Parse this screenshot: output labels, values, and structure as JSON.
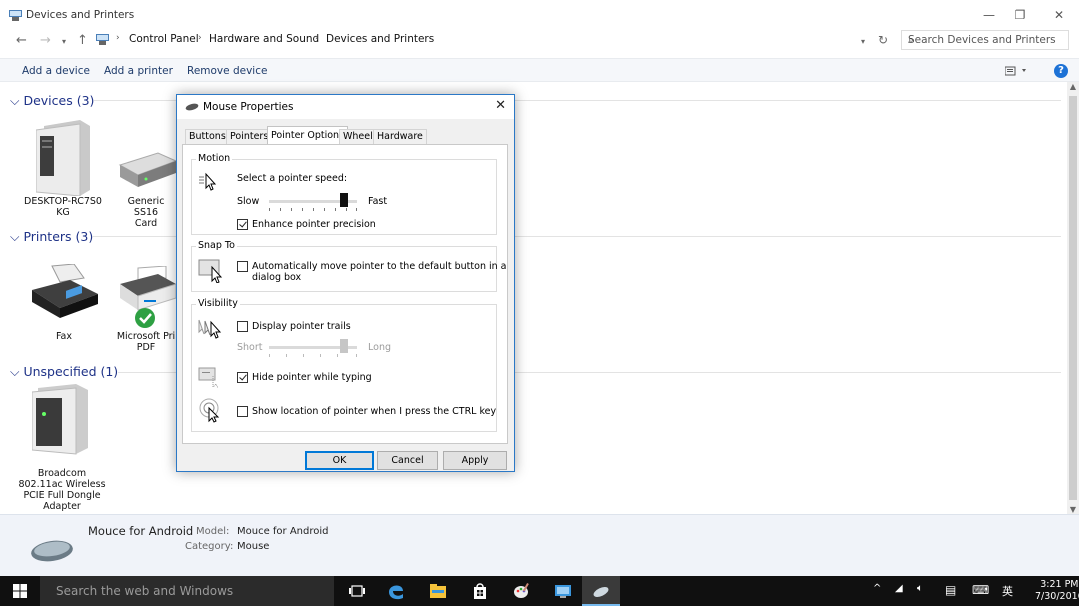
{
  "window": {
    "title": "Devices and Printers",
    "controls": [
      "—",
      "❐",
      "✕"
    ]
  },
  "address": {
    "crumbs": [
      "Control Panel",
      "Hardware and Sound",
      "Devices and Printers"
    ],
    "search_placeholder": "Search Devices and Printers"
  },
  "commands": {
    "add_device": "Add a device",
    "add_printer": "Add a printer",
    "remove_device": "Remove device",
    "help": "?"
  },
  "groups": {
    "devices": {
      "header": "Devices (3)",
      "items": [
        {
          "label1": "DESKTOP-RC7S0",
          "label2": "KG"
        },
        {
          "label1": "Generic SS16",
          "label2": "Card"
        }
      ]
    },
    "printers": {
      "header": "Printers (3)",
      "items": [
        {
          "label1": "Fax",
          "label2": ""
        },
        {
          "label1": "Microsoft Pri",
          "label2": "PDF"
        }
      ]
    },
    "unspecified": {
      "header": "Unspecified (1)",
      "items": [
        {
          "label1": "Broadcom",
          "label2": "802.11ac Wireless",
          "label3": "PCIE Full Dongle",
          "label4": "Adapter"
        }
      ]
    }
  },
  "details": {
    "name": "Mouce for Android",
    "model_key": "Model:",
    "model_value": "Mouce for Android",
    "category_key": "Category:",
    "category_value": "Mouse"
  },
  "dialog": {
    "title": "Mouse Properties",
    "tabs": [
      "Buttons",
      "Pointers",
      "Pointer Options",
      "Wheel",
      "Hardware"
    ],
    "active_tab": "Pointer Options",
    "motion": {
      "legend": "Motion",
      "prompt": "Select a pointer speed:",
      "slow": "Slow",
      "fast": "Fast",
      "speed_level": 0.85,
      "enhance": "Enhance pointer precision",
      "enhance_checked": true
    },
    "snap": {
      "legend": "Snap To",
      "line1": "Automatically move pointer to the default button in a",
      "line2": "dialog box",
      "checked": false
    },
    "visibility": {
      "legend": "Visibility",
      "trails": "Display pointer trails",
      "trails_checked": false,
      "short": "Short",
      "long": "Long",
      "trail_level": 0.85,
      "hide": "Hide pointer while typing",
      "hide_checked": true,
      "ctrl": "Show location of pointer when I press the CTRL key",
      "ctrl_checked": false
    },
    "buttons": {
      "ok": "OK",
      "cancel": "Cancel",
      "apply": "Apply"
    }
  },
  "taskbar": {
    "search": "Search the web and Windows",
    "time": "3:21 PM",
    "date": "7/30/2016",
    "ime": "英"
  },
  "colors": {
    "accent": "#0078d7",
    "header_text": "#1e3287",
    "taskbar": "#101010"
  }
}
